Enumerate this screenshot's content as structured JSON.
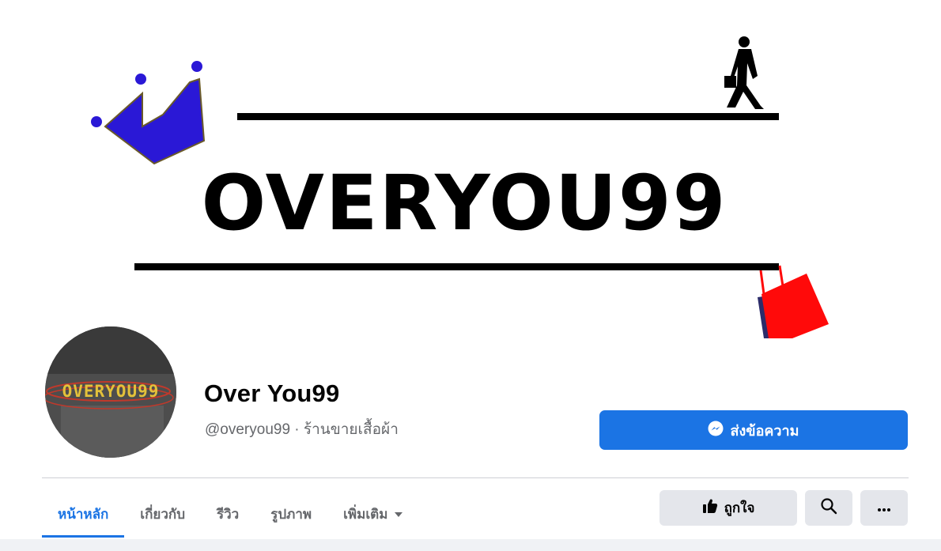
{
  "cover": {
    "logo_text": "OVERYOU99",
    "colors": {
      "crown": "#2a18d6",
      "bag": "#ff0a0a",
      "ink": "#000000"
    }
  },
  "avatar": {
    "text": "OVERYOU99"
  },
  "page": {
    "name": "Over You99",
    "subtitle": "@overyou99 · ร้านขายเสื้อผ้า"
  },
  "actions": {
    "message_label": "ส่งข้อความ",
    "like_label": "ถูกใจ"
  },
  "tabs": [
    {
      "label": "หน้าหลัก",
      "active": true
    },
    {
      "label": "เกี่ยวกับ"
    },
    {
      "label": "รีวิว"
    },
    {
      "label": "รูปภาพ"
    },
    {
      "label": "เพิ่มเติม"
    }
  ],
  "icons": {
    "messenger": "messenger-icon",
    "dropdown": "caret-down-icon",
    "like": "thumbs-up-icon",
    "search": "search-icon",
    "more": "more-icon"
  },
  "colors": {
    "accent": "#1b74e4",
    "muted": "#65676b",
    "button_gray": "#e4e6eb"
  }
}
